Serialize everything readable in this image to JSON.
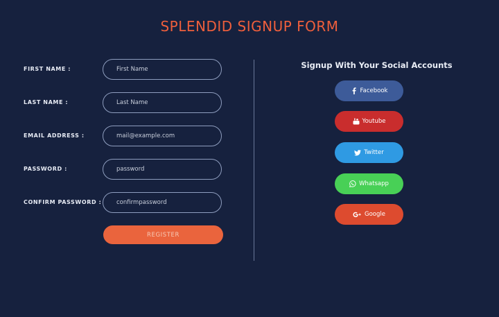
{
  "header": {
    "title": "SPLENDID SIGNUP FORM"
  },
  "form": {
    "fields": [
      {
        "label": "FIRST NAME :",
        "placeholder": "First Name",
        "value": ""
      },
      {
        "label": "LAST NAME :",
        "placeholder": "Last Name",
        "value": ""
      },
      {
        "label": "EMAIL ADDRESS :",
        "placeholder": "mail@example.com",
        "value": ""
      },
      {
        "label": "PASSWORD :",
        "placeholder": "password",
        "value": ""
      },
      {
        "label": "CONFIRM PASSWORD :",
        "placeholder": "confirmpassword",
        "value": ""
      }
    ],
    "register_label": "REGISTER"
  },
  "social": {
    "heading": "Signup With Your Social Accounts",
    "buttons": [
      {
        "label": "Facebook",
        "icon": "facebook-icon",
        "color": "#3d5b99"
      },
      {
        "label": "Youtube",
        "icon": "youtube-icon",
        "color": "#c92d2d"
      },
      {
        "label": "Twitter",
        "icon": "twitter-icon",
        "color": "#2f9ae3"
      },
      {
        "label": "Whatsapp",
        "icon": "whatsapp-icon",
        "color": "#48d056"
      },
      {
        "label": "Google",
        "icon": "google-plus-icon",
        "color": "#dd4b2f"
      }
    ]
  },
  "colors": {
    "background": "#16213e",
    "accent": "#ef5f3c",
    "register_button": "#ea643d"
  }
}
